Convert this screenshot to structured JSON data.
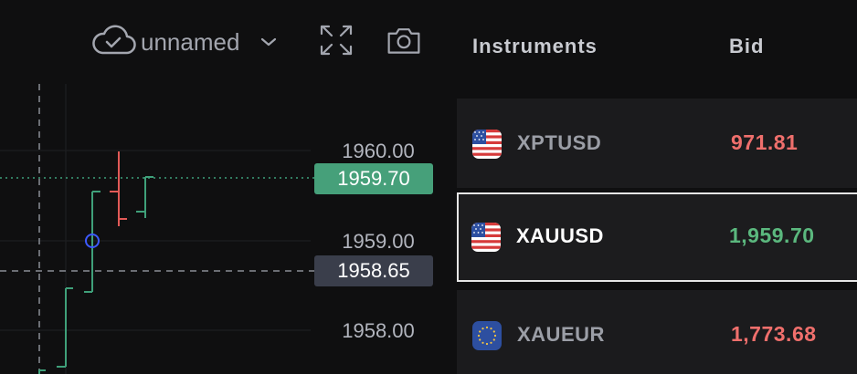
{
  "toolbar": {
    "layout_name": "unnamed",
    "icons": [
      "cloud-check-icon",
      "chevron-down-icon",
      "fullscreen-icon",
      "camera-icon"
    ]
  },
  "chart": {
    "price_axis": [
      "1960.00",
      "1959.00",
      "1958.00"
    ],
    "last_price": "1959.70",
    "crosshair_price": "1958.65",
    "colors": {
      "up": "#3fa07a",
      "down": "#e25a57",
      "last_tag": "#46a07a",
      "crosshair_tag": "#3a3e4b",
      "marker": "#3d5afe"
    }
  },
  "watchlist": {
    "headers": {
      "instruments": "Instruments",
      "bid": "Bid"
    },
    "rows": [
      {
        "symbol": "XPTUSD",
        "bid": "971.81",
        "bid_color": "#ef6f6c",
        "flag": "us-flag-icon",
        "selected": false
      },
      {
        "symbol": "XAUUSD",
        "bid": "1,959.70",
        "bid_color": "#5bb87e",
        "flag": "us-flag-icon",
        "selected": true
      },
      {
        "symbol": "XAUEUR",
        "bid": "1,773.68",
        "bid_color": "#ef6f6c",
        "flag": "eu-flag-icon",
        "selected": false
      }
    ]
  }
}
